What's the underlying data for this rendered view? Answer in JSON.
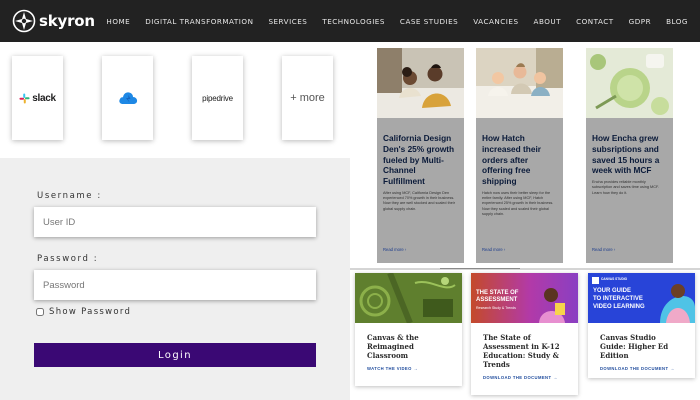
{
  "nav": {
    "logo_text": "skyron",
    "items": [
      {
        "label": "HOME"
      },
      {
        "label": "DIGITAL TRANSFORMATION"
      },
      {
        "label": "SERVICES"
      },
      {
        "label": "TECHNOLOGIES"
      },
      {
        "label": "CASE STUDIES"
      },
      {
        "label": "VACANCIES"
      },
      {
        "label": "ABOUT"
      },
      {
        "label": "CONTACT"
      },
      {
        "label": "GDPR"
      },
      {
        "label": "BLOG"
      }
    ]
  },
  "integrations": [
    {
      "name": "slack",
      "label": "slack",
      "icon": "slack-icon"
    },
    {
      "name": "cloud",
      "label": "",
      "icon": "cloud-icon"
    },
    {
      "name": "pipedrive",
      "label": "pipedrive",
      "icon": ""
    },
    {
      "name": "more",
      "label": "+ more",
      "icon": ""
    }
  ],
  "login": {
    "username_label": "Username :",
    "username_placeholder": "User ID",
    "password_label": "Password :",
    "password_placeholder": "Password",
    "show_password_label": "Show Password",
    "login_button": "Login",
    "button_color": "#3a0874"
  },
  "case_studies": [
    {
      "title": "California Design Den's 25% growth fueled by Multi-Channel Fulfillment",
      "description": "After using MCF, California Design Den experienced 70% growth in their business. Now they are well stocked and scaled their global supply chain.",
      "read_more": "Read more ›"
    },
    {
      "title": "How Hatch increased their orders after offering free shipping",
      "description": "Hatch now uses their better sleep for the entire family. After using MCF, Hatch experienced 25% growth in their business. Now they scaled and scaled their global supply chain.",
      "read_more": "Read more ›"
    },
    {
      "title": "How Encha grew subsriptions and saved 15 hours a week with MCF",
      "description": "Encha provides reliable monthly subscription and saves time using MCF. Learn how they do it.",
      "read_more": "Read more ›"
    }
  ],
  "resources": [
    {
      "title": "Canvas & the Reimagined Classroom",
      "link": "WATCH THE VIDEO →",
      "banner_lines": []
    },
    {
      "title": "The State of Assessment in K-12 Education: Study & Trends",
      "link": "DOWNLOAD THE DOCUMENT →",
      "banner_lines": [
        "THE STATE OF",
        "ASSESSMENT",
        "Research Study & Trends"
      ]
    },
    {
      "title": "Canvas Studio Guide: Higher Ed Edition",
      "link": "DOWNLOAD THE DOCUMENT →",
      "banner_lines": [
        "CANVAS STUDIO",
        "YOUR GUIDE",
        "TO INTERACTIVE",
        "VIDEO LEARNING"
      ]
    }
  ],
  "colors": {
    "nav_bg": "#222222",
    "case_card_bg": "#a8a8a8",
    "link_blue": "#1d4a9c"
  }
}
